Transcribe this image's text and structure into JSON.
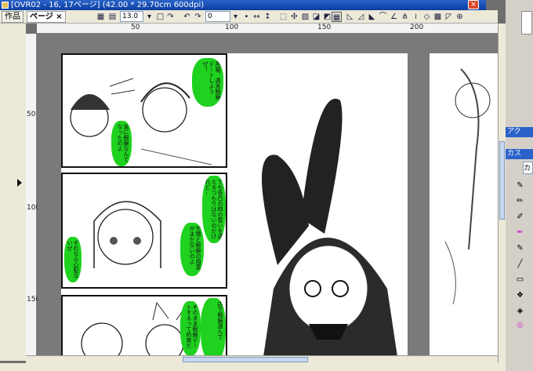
{
  "window": {
    "title": "[OVR02 - 16, 17ページ] (42.00 * 29.70cm 600dpi)",
    "close_glyph": "×"
  },
  "tabs": [
    {
      "label": "作品"
    },
    {
      "label": "ページ"
    }
  ],
  "tab_close": "×",
  "toolbar": {
    "brush_size": "13.0",
    "rotation": "0"
  },
  "ruler": {
    "top_ticks": [
      "50",
      "100",
      "150",
      "200"
    ],
    "left_ticks": [
      "50",
      "100",
      "150"
    ]
  },
  "manga": {
    "bubbles": [
      "黒猫、週末眼鏡デートしようぜ！",
      "急に眼鏡なんてなったのよ",
      "でも告白の時の誓いを違えるつもりはないのだけれど…",
      "生憎と眼鏡の用意がまだないのよ",
      "それなら心配ないぜ",
      "そのまま眼鏡デートするって約束だ",
      "店で眼鏡選んで"
    ]
  },
  "right_panel": {
    "header1": "アク",
    "header2": "カス",
    "field": "カ"
  }
}
